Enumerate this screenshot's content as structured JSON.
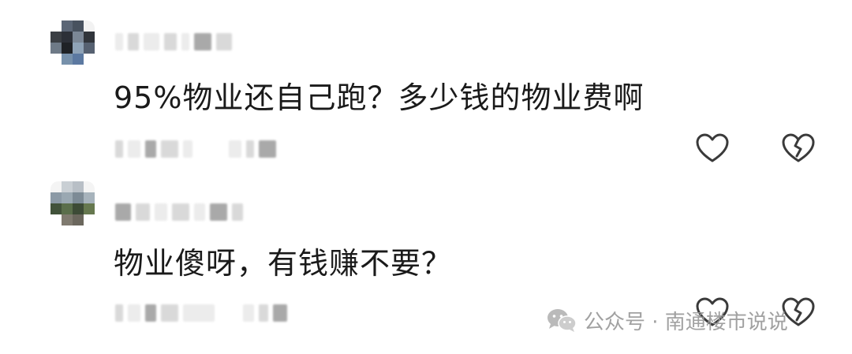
{
  "comments": [
    {
      "text": "95%物业还自己跑？多少钱的物业费啊",
      "avatar_icon": "blurred-profile-photo-icon",
      "like_icon": "heart-outline-icon",
      "dislike_icon": "broken-heart-outline-icon"
    },
    {
      "text": "物业傻呀，有钱赚不要？",
      "avatar_icon": "blurred-profile-photo-icon",
      "like_icon": "heart-outline-icon",
      "dislike_icon": "broken-heart-outline-icon"
    }
  ],
  "watermark": {
    "icon": "wechat-icon",
    "text": "公众号 · 南通楼市说说"
  },
  "colors": {
    "text": "#1a1a1a",
    "icon_stroke": "#3a3a3a",
    "watermark": "#9a9a9a",
    "background": "#ffffff"
  }
}
